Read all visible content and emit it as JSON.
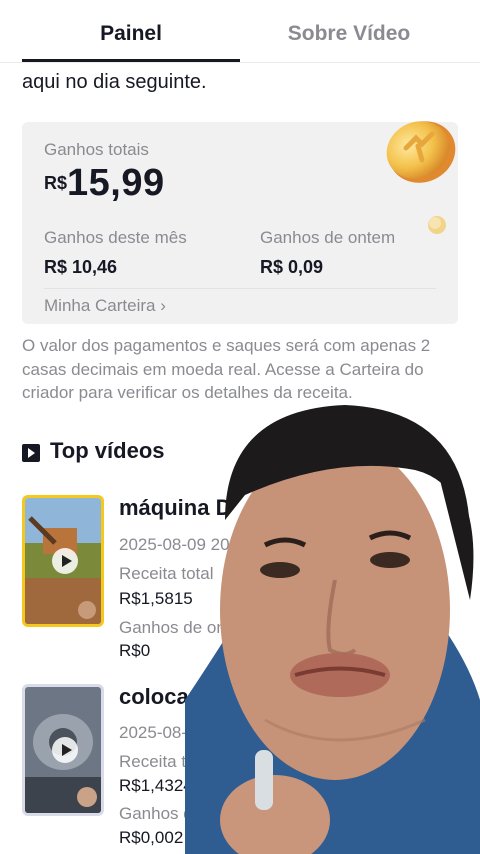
{
  "tabs": {
    "active": "Painel",
    "inactive": "Sobre Vídeo"
  },
  "intro_text": "aqui no dia seguinte.",
  "earnings": {
    "total_label": "Ganhos totais",
    "currency": "R$",
    "total_value": "15,99",
    "month_label": "Ganhos deste mês",
    "month_value": "R$ 10,46",
    "yesterday_label": "Ganhos de ontem",
    "yesterday_value": "R$ 0,09",
    "wallet_link": "Minha Carteira ›"
  },
  "note": "O valor dos pagamentos e saques será com apenas 2 casas decimais em moeda real. Acesse a Carteira do criador para verificar os detalhes da receita.",
  "top_videos": {
    "title": "Top vídeos",
    "items": [
      {
        "title": "máquina D",
        "date": "2025-08-09 20",
        "revenue_label": "Receita total",
        "revenue": "R$1,5815",
        "yesterday_label": "Ganhos de onte",
        "yesterday": "R$0"
      },
      {
        "title": "colocando a n",
        "date": "2025-08-09 13:34",
        "revenue_label": "Receita total",
        "revenue": "R$1,4324",
        "yesterday_label": "Ganhos de",
        "yesterday": "R$0,002"
      }
    ]
  },
  "colors": {
    "text": "#161823",
    "muted": "#8a8b91",
    "card_bg": "#f1f1f2",
    "thumb_border_1": "#f5c81e"
  },
  "icons": [
    "coin-icon",
    "play-square-icon",
    "play-icon"
  ]
}
